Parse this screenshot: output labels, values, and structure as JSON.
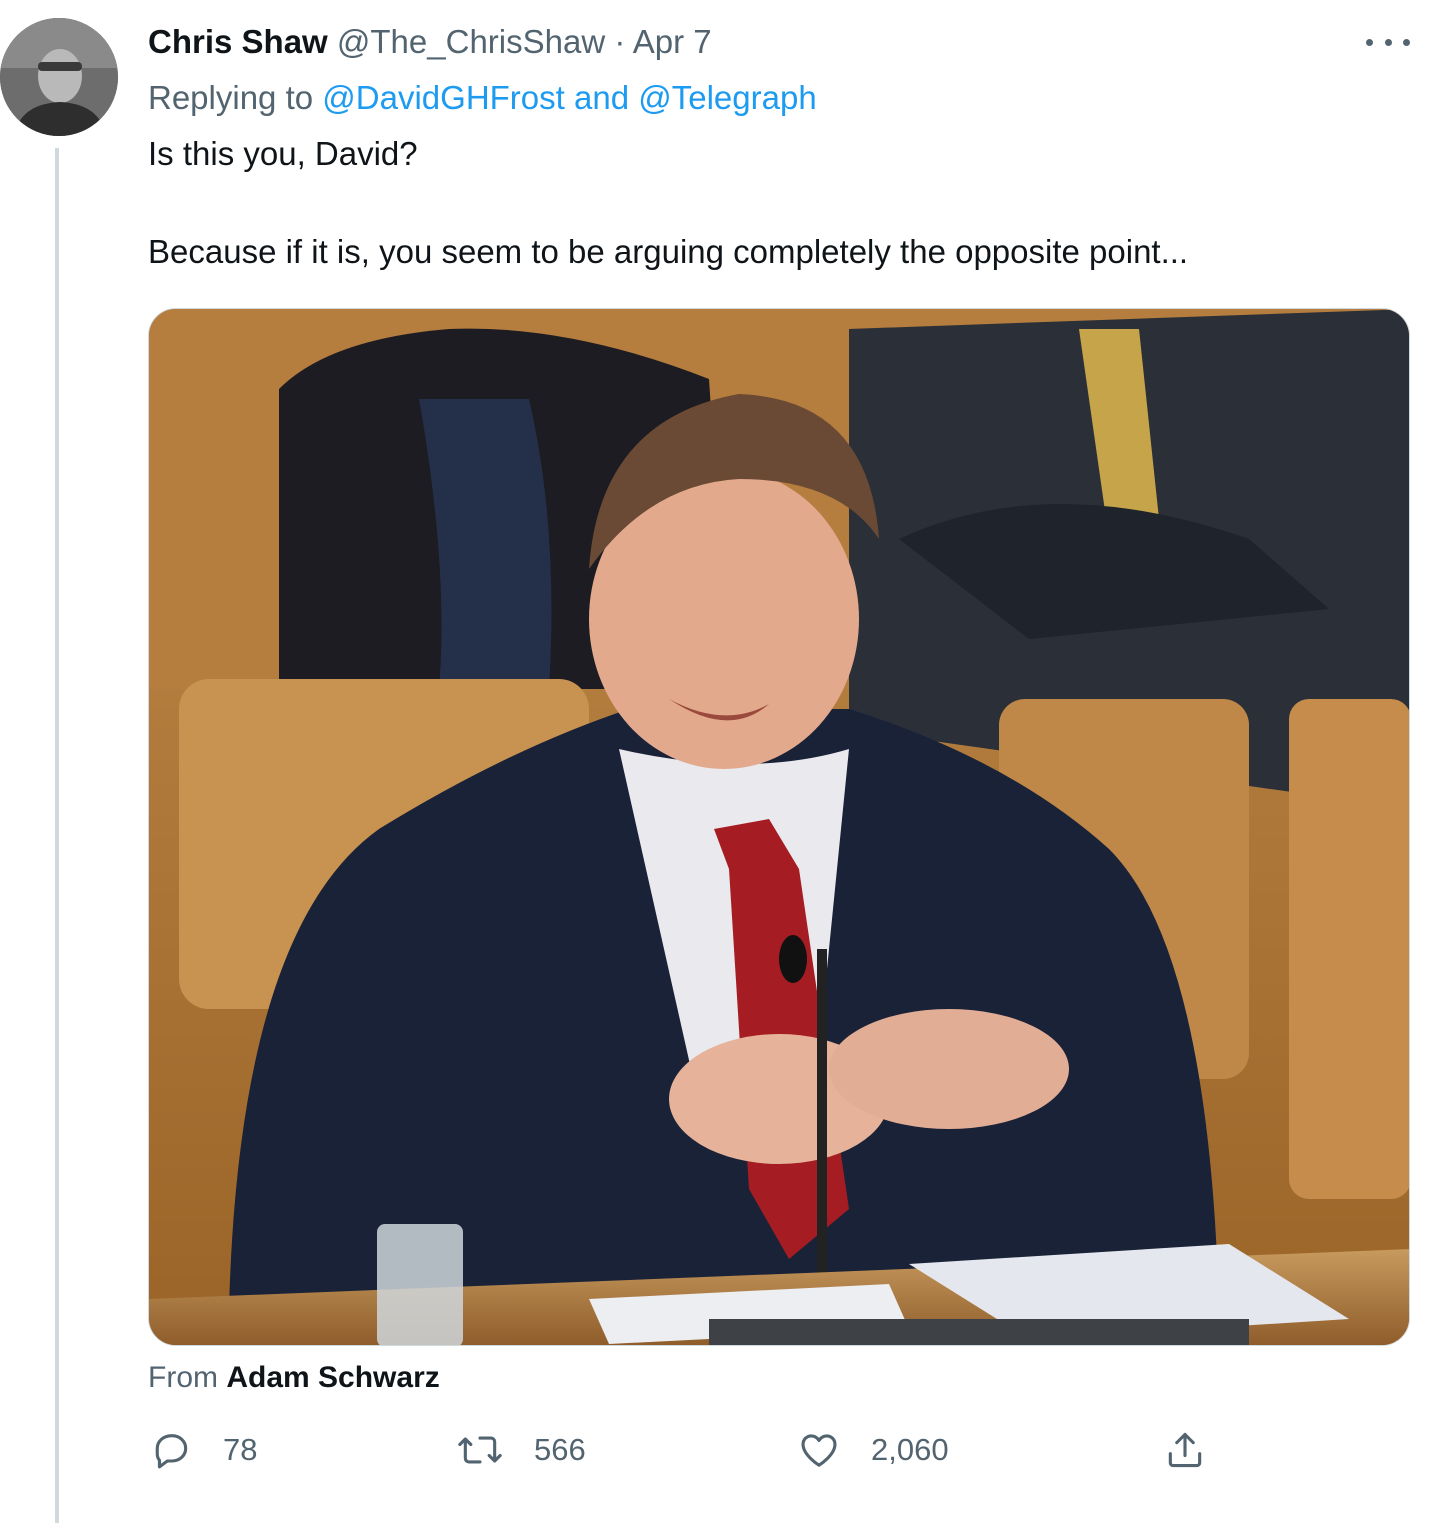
{
  "tweet": {
    "author_name": "Chris Shaw",
    "handle": "@The_ChrisShaw",
    "separator": "·",
    "date": "Apr 7",
    "replying_prefix": "Replying to",
    "replying_to_1": "@DavidGHFrost",
    "replying_and": "and",
    "replying_to_2": "@Telegraph",
    "text_line_1": "Is this you, David?",
    "text_line_2": "Because if it is, you seem to be arguing completely the opposite point...",
    "media_attribution_prefix": "From",
    "media_attribution_name": "Adam Schwarz"
  },
  "actions": {
    "reply_count": "78",
    "retweet_count": "566",
    "like_count": "2,060"
  },
  "icons": {
    "more": "more-horizontal-icon",
    "reply": "speech-bubble-icon",
    "retweet": "retweet-icon",
    "like": "heart-icon",
    "share": "share-icon"
  },
  "colors": {
    "link": "#1d9bf0",
    "muted": "#536471",
    "text": "#0f1419"
  }
}
